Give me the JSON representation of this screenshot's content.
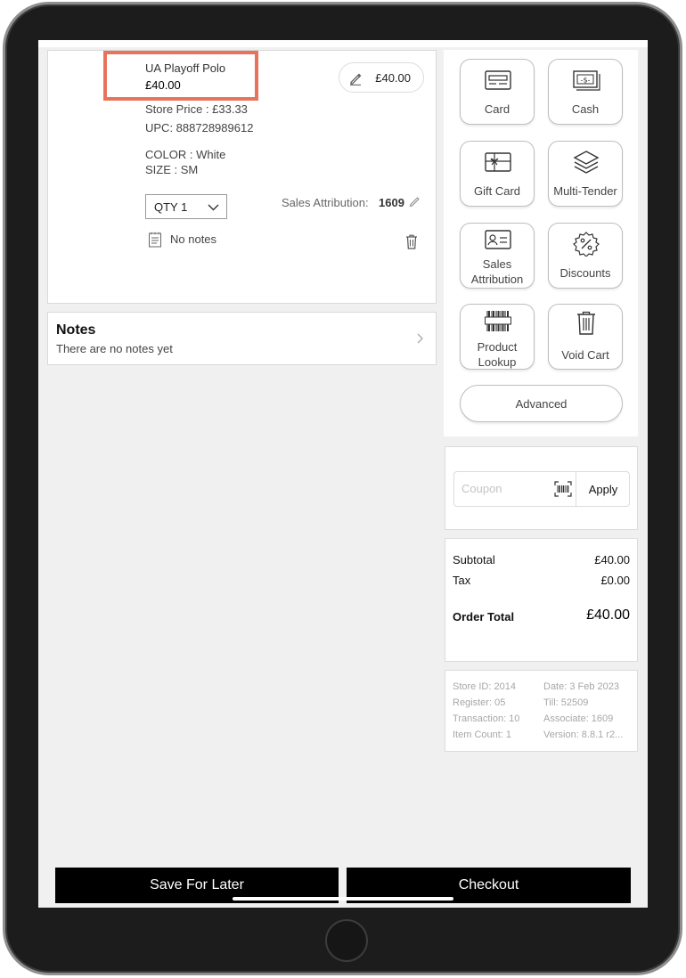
{
  "cart_item": {
    "name": "UA Playoff Polo",
    "price": "£40.00",
    "store_price": "Store Price : £33.33",
    "upc": "UPC: 888728989612",
    "color": "COLOR : White",
    "size": "SIZE : SM",
    "edit_price_label": "£40.00",
    "qty_label": "QTY 1",
    "sales_attribution_label": "Sales Attribution:",
    "sales_attribution_value": "1609",
    "notes_label": "No notes"
  },
  "notes": {
    "title": "Notes",
    "subtitle": "There are no notes yet"
  },
  "actions": {
    "card": "Card",
    "cash": "Cash",
    "gift_card": "Gift Card",
    "multi_tender": "Multi-Tender",
    "sales_attribution_line1": "Sales",
    "sales_attribution_line2": "Attribution",
    "discounts": "Discounts",
    "product_lookup_line1": "Product",
    "product_lookup_line2": "Lookup",
    "void_cart": "Void Cart",
    "advanced": "Advanced"
  },
  "coupon": {
    "placeholder": "Coupon",
    "apply_label": "Apply"
  },
  "totals": {
    "subtotal_label": "Subtotal",
    "subtotal_value": "£40.00",
    "tax_label": "Tax",
    "tax_value": "£0.00",
    "order_total_label": "Order Total",
    "order_total_value": "£40.00"
  },
  "info": {
    "store_id": "Store ID: 2014",
    "date": "Date: 3 Feb 2023",
    "register": "Register: 05",
    "till": "Till: 52509",
    "transaction": "Transaction: 10",
    "associate": "Associate: 1609",
    "item_count": "Item Count: 1",
    "version": "Version: 8.8.1 r2..."
  },
  "footer": {
    "save_label": "Save For Later",
    "checkout_label": "Checkout"
  },
  "colors": {
    "highlight": "#e8735b",
    "primary_button": "#000000",
    "background": "#f0f0f0"
  }
}
